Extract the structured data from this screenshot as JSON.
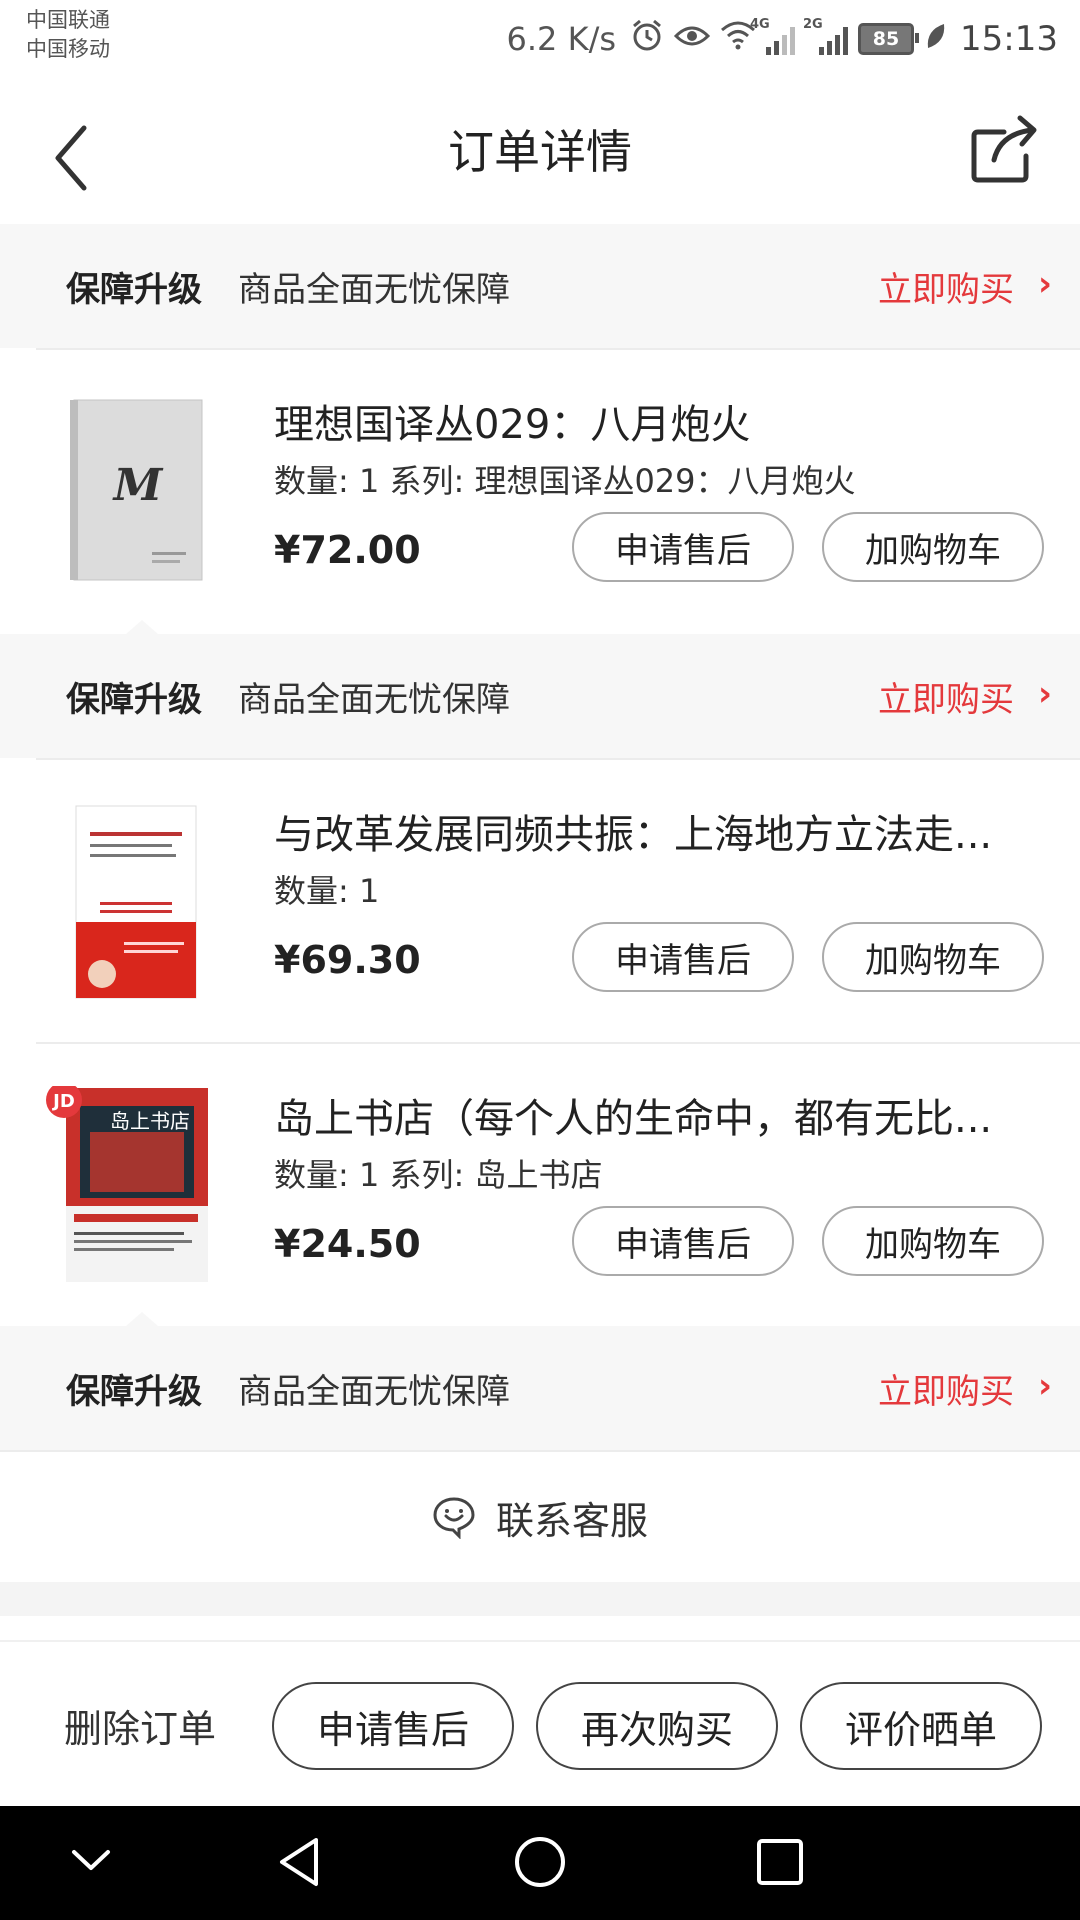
{
  "status_bar": {
    "carrier_1": "中国联通",
    "carrier_2": "中国移动",
    "speed": "6.2 K/s",
    "signal_1_tag": "4G",
    "signal_2_tag": "2G",
    "battery": "85",
    "time": "15:13"
  },
  "nav": {
    "title": "订单详情",
    "back_icon": "chevron-left-icon",
    "share_icon": "share-icon"
  },
  "guarantee": {
    "title": "保障升级",
    "desc": "商品全面无忧保障",
    "buy_label": "立即购买",
    "arrow": "›"
  },
  "products": [
    {
      "name": "理想国译丛029：八月炮火",
      "meta": "数量: 1 系列: 理想国译丛029：八月炮火",
      "price": "¥72.00",
      "after_sale": "申请售后",
      "add_cart": "加购物车",
      "cover_text": "M"
    },
    {
      "name": "与改革发展同频共振：上海地方立法走...",
      "meta": "数量: 1",
      "price": "¥69.30",
      "after_sale": "申请售后",
      "add_cart": "加购物车"
    },
    {
      "name": "岛上书店（每个人的生命中，都有无比...",
      "meta": "数量: 1 系列: 岛上书店",
      "price": "¥24.50",
      "after_sale": "申请售后",
      "add_cart": "加购物车",
      "cover_badge": "JD",
      "cover_title": "岛上书店"
    }
  ],
  "service": {
    "label": "联系客服",
    "icon": "chat-smile-icon"
  },
  "actions": {
    "delete": "删除订单",
    "after_sale": "申请售后",
    "rebuy": "再次购买",
    "review": "评价晒单"
  },
  "colors": {
    "accent": "#e4393c",
    "bg_gray": "#f7f7f7"
  }
}
